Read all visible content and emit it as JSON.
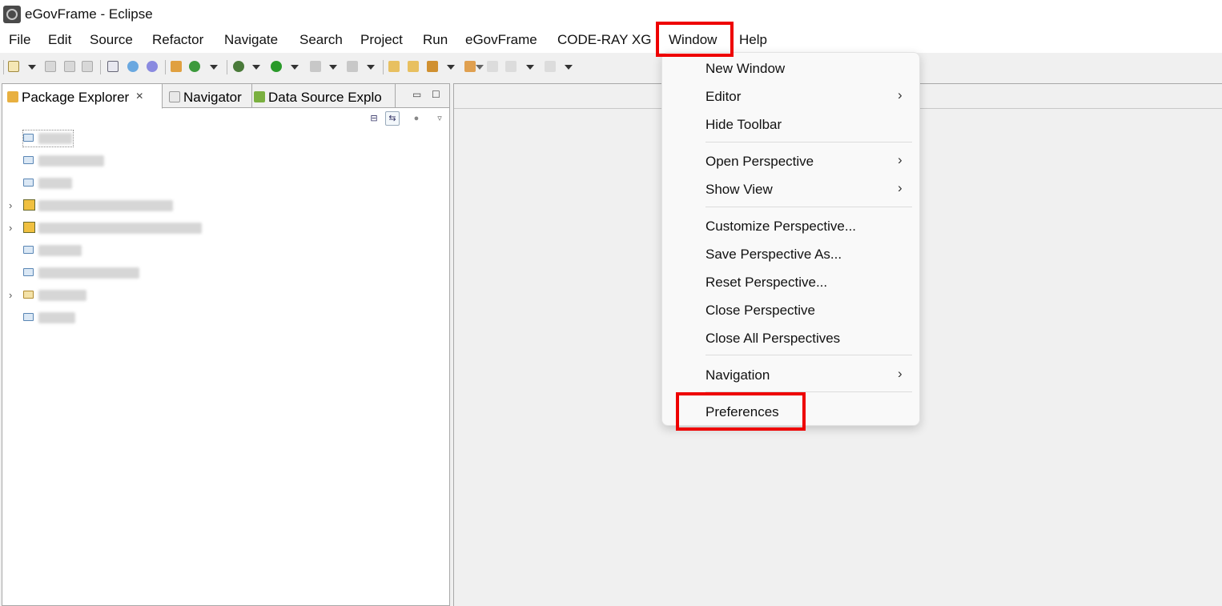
{
  "window": {
    "title": "eGovFrame - Eclipse"
  },
  "menubar": {
    "items": [
      "File",
      "Edit",
      "Source",
      "Refactor",
      "Navigate",
      "Search",
      "Project",
      "Run",
      "eGovFrame",
      "CODE-RAY XG",
      "Window",
      "Help"
    ],
    "highlighted": "Window"
  },
  "left_panel": {
    "tabs": [
      {
        "label": "Package Explorer",
        "icon": "package-icon",
        "active": true
      },
      {
        "label": "Navigator",
        "icon": "navigator-icon",
        "active": false
      },
      {
        "label": "Data Source Explo",
        "icon": "datasource-icon",
        "active": false
      }
    ],
    "controls": {
      "minimize": "▭",
      "maximize": "☐"
    },
    "tree_items": [
      {
        "type": "folder",
        "expandable": false,
        "name_redacted": true
      },
      {
        "type": "folder",
        "expandable": false,
        "name_redacted": true
      },
      {
        "type": "folder",
        "expandable": false,
        "name_redacted": true
      },
      {
        "type": "project",
        "expandable": true,
        "name_redacted": true
      },
      {
        "type": "project",
        "expandable": true,
        "name_redacted": true
      },
      {
        "type": "folder",
        "expandable": false,
        "name_redacted": true
      },
      {
        "type": "folder",
        "expandable": false,
        "name_redacted": true
      },
      {
        "type": "open-folder",
        "expandable": true,
        "name_redacted": true
      },
      {
        "type": "folder",
        "expandable": false,
        "name_redacted": true
      }
    ]
  },
  "window_menu": {
    "groups": [
      [
        {
          "label": "New Window",
          "submenu": false
        },
        {
          "label": "Editor",
          "submenu": true
        },
        {
          "label": "Hide Toolbar",
          "submenu": false
        }
      ],
      [
        {
          "label": "Open Perspective",
          "submenu": true
        },
        {
          "label": "Show View",
          "submenu": true
        }
      ],
      [
        {
          "label": "Customize Perspective...",
          "submenu": false
        },
        {
          "label": "Save Perspective As...",
          "submenu": false
        },
        {
          "label": "Reset Perspective...",
          "submenu": false
        },
        {
          "label": "Close Perspective",
          "submenu": false
        },
        {
          "label": "Close All Perspectives",
          "submenu": false
        }
      ],
      [
        {
          "label": "Navigation",
          "submenu": true
        }
      ],
      [
        {
          "label": "Preferences",
          "submenu": false
        }
      ]
    ],
    "highlighted": "Preferences",
    "submenu_glyph": "›"
  },
  "colors": {
    "highlight": "#ee0000",
    "workbench_bg": "#f0f0f0",
    "menu_bg": "#f9f9f9"
  }
}
